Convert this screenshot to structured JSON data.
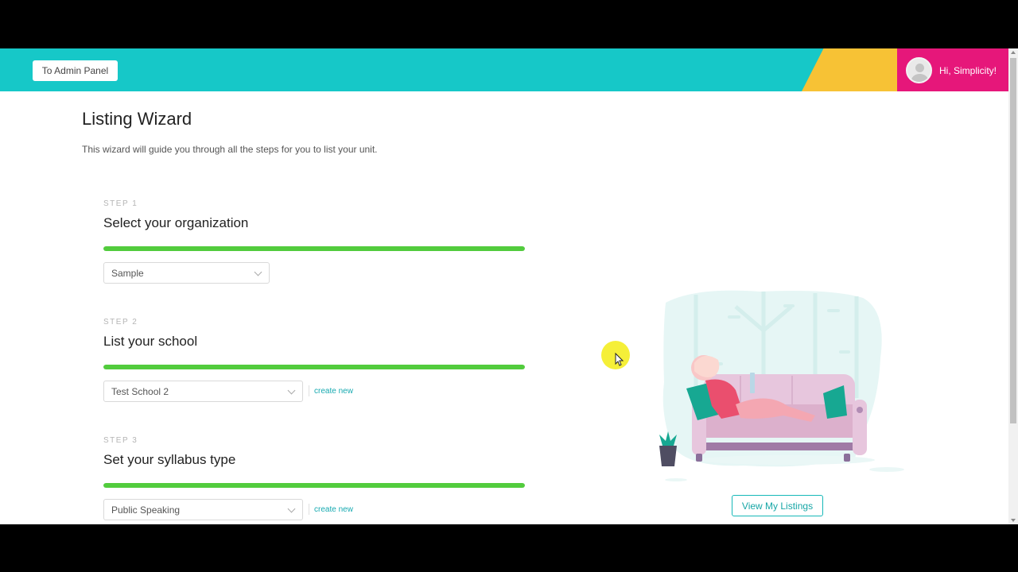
{
  "header": {
    "admin_button": "To Admin Panel",
    "greeting": "Hi, Simplicity!",
    "colors": {
      "teal": "#16c8c8",
      "yellow": "#f7c235",
      "pink": "#e6177a"
    }
  },
  "page": {
    "title": "Listing Wizard",
    "subtitle": "This wizard will guide you through all the steps for you to list your unit."
  },
  "steps": [
    {
      "label": "STEP 1",
      "title": "Select your organization",
      "progress": 1.0,
      "select_value": "Sample",
      "create_new": ""
    },
    {
      "label": "STEP 2",
      "title": "List your school",
      "progress": 1.0,
      "select_value": "Test School 2",
      "create_new": "create new"
    },
    {
      "label": "STEP 3",
      "title": "Set your syllabus type",
      "progress": 1.0,
      "select_value": "Public Speaking",
      "create_new": "create new"
    }
  ],
  "view_listings_button": "View My Listings",
  "progress_color": "#52cc3d"
}
